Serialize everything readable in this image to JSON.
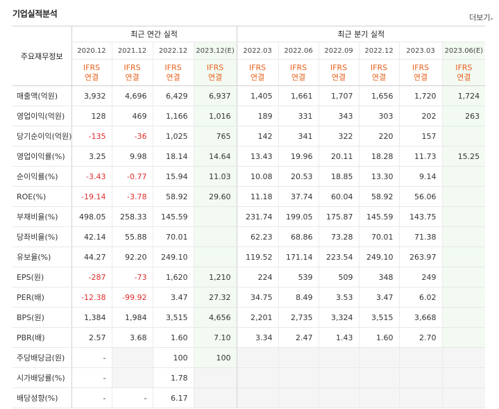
{
  "section": {
    "title": "기업실적분석",
    "more_label": "더보기"
  },
  "header": {
    "annual_label": "최근 연간 실적",
    "quarter_label": "최근 분기 실적",
    "row_label": "주요재무정보",
    "periods": [
      "2020.12",
      "2021.12",
      "2022.12",
      "2023.12(E)",
      "2022.03",
      "2022.06",
      "2022.09",
      "2022.12",
      "2023.03",
      "2023.06(E)"
    ],
    "basis_line1": "IFRS",
    "basis_line2": "연결"
  },
  "rows": [
    {
      "label": "매출액(억원)",
      "values": [
        "3,932",
        "4,696",
        "6,429",
        "6,937",
        "1,405",
        "1,661",
        "1,707",
        "1,656",
        "1,720",
        "1,724"
      ]
    },
    {
      "label": "영업이익(억원)",
      "values": [
        "128",
        "469",
        "1,166",
        "1,016",
        "189",
        "331",
        "343",
        "303",
        "202",
        "263"
      ]
    },
    {
      "label": "당기순이익(억원)",
      "values": [
        "-135",
        "-36",
        "1,025",
        "765",
        "142",
        "341",
        "322",
        "220",
        "157",
        ""
      ]
    },
    {
      "label": "영업이익률(%)",
      "values": [
        "3.25",
        "9.98",
        "18.14",
        "14.64",
        "13.43",
        "19.96",
        "20.11",
        "18.28",
        "11.73",
        "15.25"
      ]
    },
    {
      "label": "순이익률(%)",
      "values": [
        "-3.43",
        "-0.77",
        "15.94",
        "11.03",
        "10.08",
        "20.53",
        "18.85",
        "13.30",
        "9.14",
        ""
      ]
    },
    {
      "label": "ROE(%)",
      "values": [
        "-19.14",
        "-3.78",
        "58.92",
        "29.60",
        "11.18",
        "37.74",
        "60.04",
        "58.92",
        "56.06",
        ""
      ]
    },
    {
      "label": "부채비율(%)",
      "values": [
        "498.05",
        "258.33",
        "145.59",
        "",
        "231.74",
        "199.05",
        "175.87",
        "145.59",
        "143.75",
        ""
      ]
    },
    {
      "label": "당좌비율(%)",
      "values": [
        "42.14",
        "55.88",
        "70.01",
        "",
        "62.23",
        "68.86",
        "73.28",
        "70.01",
        "71.38",
        ""
      ]
    },
    {
      "label": "유보율(%)",
      "values": [
        "44.27",
        "92.20",
        "249.10",
        "",
        "119.52",
        "171.14",
        "223.54",
        "249.10",
        "263.97",
        ""
      ]
    },
    {
      "label": "EPS(원)",
      "values": [
        "-287",
        "-73",
        "1,620",
        "1,210",
        "224",
        "539",
        "509",
        "348",
        "249",
        ""
      ]
    },
    {
      "label": "PER(배)",
      "values": [
        "-12.38",
        "-99.92",
        "3.47",
        "27.32",
        "34.75",
        "8.49",
        "3.53",
        "3.47",
        "6.02",
        ""
      ]
    },
    {
      "label": "BPS(원)",
      "values": [
        "1,384",
        "1,984",
        "3,515",
        "4,656",
        "2,201",
        "2,735",
        "3,324",
        "3,515",
        "3,668",
        ""
      ]
    },
    {
      "label": "PBR(배)",
      "values": [
        "2.57",
        "3.68",
        "1.60",
        "7.10",
        "3.34",
        "2.47",
        "1.43",
        "1.60",
        "2.70",
        ""
      ]
    },
    {
      "label": "주당배당금(원)",
      "values": [
        "-",
        "",
        "100",
        "100",
        "",
        "",
        "",
        "",
        "",
        ""
      ]
    },
    {
      "label": "시가배당률(%)",
      "values": [
        "-",
        "",
        "1.78",
        "",
        "",
        "",
        "",
        "",
        "",
        ""
      ]
    },
    {
      "label": "배당성향(%)",
      "values": [
        "-",
        "-",
        "6.17",
        "",
        "",
        "",
        "",
        "",
        "",
        ""
      ]
    }
  ],
  "colors": {
    "negative": "#e02b2b",
    "basis": "#e8601c",
    "estimate_bg": "#f2faf2",
    "blank_bg": "#f5f5f5"
  }
}
